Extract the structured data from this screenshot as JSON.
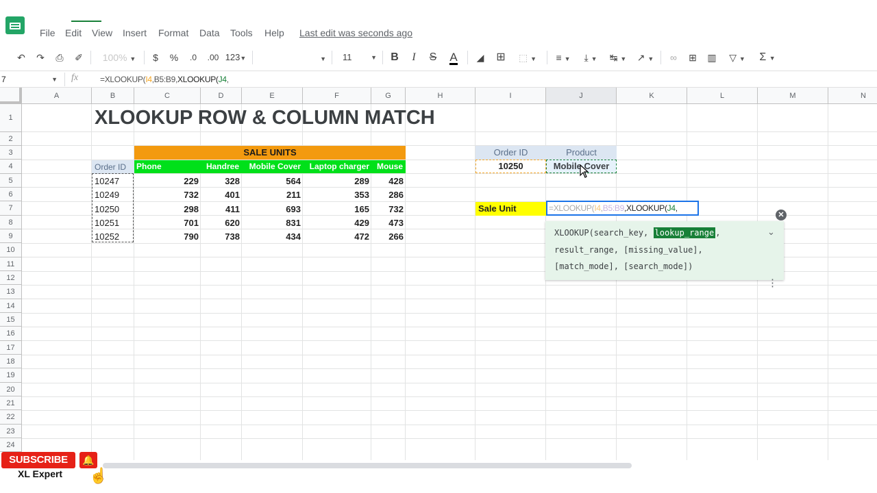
{
  "menu": [
    "File",
    "Edit",
    "View",
    "Insert",
    "Format",
    "Data",
    "Tools",
    "Help"
  ],
  "last_edit": "Last edit was seconds ago",
  "toolbar": {
    "zoom": "100%",
    "currency": "$",
    "percent": "%",
    "dec_decrease": ".0",
    "dec_increase": ".00",
    "more_formats": "123",
    "font_size": "11",
    "bold": "B",
    "italic": "I",
    "strike": "S",
    "text_color": "A"
  },
  "formula_bar": {
    "name_box": "7",
    "fx": "fx",
    "formula_part1": "=XLOOKUP(",
    "formula_ref1": "I4",
    "formula_part2": ",B5:B9,",
    "formula_part3": "XLOOKUP(",
    "formula_ref2": "J4",
    "formula_part4": ","
  },
  "columns": [
    "A",
    "B",
    "C",
    "D",
    "E",
    "F",
    "G",
    "H",
    "I",
    "J",
    "K",
    "L",
    "M",
    "N"
  ],
  "rows": [
    "1",
    "2",
    "3",
    "4",
    "5",
    "6",
    "7",
    "8",
    "9",
    "10",
    "11",
    "12",
    "13",
    "14",
    "15",
    "16",
    "17",
    "18",
    "19",
    "20",
    "21",
    "22",
    "23",
    "24"
  ],
  "sheet": {
    "title": "XLOOKUP ROW & COLUMN MATCH",
    "sale_units_header": "SALE UNITS",
    "order_id_label": "Order ID",
    "product_headers": [
      "Phone",
      "Handree",
      "Mobile Cover",
      "Laptop charger",
      "Mouse"
    ],
    "order_ids": [
      "10247",
      "10249",
      "10250",
      "10251",
      "10252"
    ],
    "values": [
      [
        "229",
        "328",
        "564",
        "289",
        "428"
      ],
      [
        "732",
        "401",
        "211",
        "353",
        "286"
      ],
      [
        "298",
        "411",
        "693",
        "165",
        "732"
      ],
      [
        "701",
        "620",
        "831",
        "429",
        "473"
      ],
      [
        "790",
        "738",
        "434",
        "472",
        "266"
      ]
    ],
    "lookup_order_label": "Order ID",
    "lookup_product_label": "Product",
    "lookup_order_value": "10250",
    "lookup_product_value": "Mobile Cover",
    "sale_unit_label": "Sale Unit",
    "editing_cell": {
      "part1": "=XLOOKUP(",
      "ref1": "I4",
      "part2": ",",
      "ref2": "B5:B9",
      "part3": ",XLOOKUP(",
      "ref3": "J4",
      "part4": ","
    }
  },
  "suggestion": {
    "fn_start": "XLOOKUP(search_key, ",
    "fn_highlight": "lookup_range",
    "fn_comma": ",",
    "line2": "result_range, [missing_value],",
    "line3": "[match_mode], [search_mode])"
  },
  "overlay": {
    "subscribe": "SUBSCRIBE",
    "channel": "XL Expert"
  },
  "colors": {
    "orange": "#f39a0f",
    "green": "#00e01a",
    "yellow": "#ffff00",
    "accent_green": "#188038",
    "selection_blue": "#1a73e8",
    "subscribe_red": "#e62117"
  }
}
